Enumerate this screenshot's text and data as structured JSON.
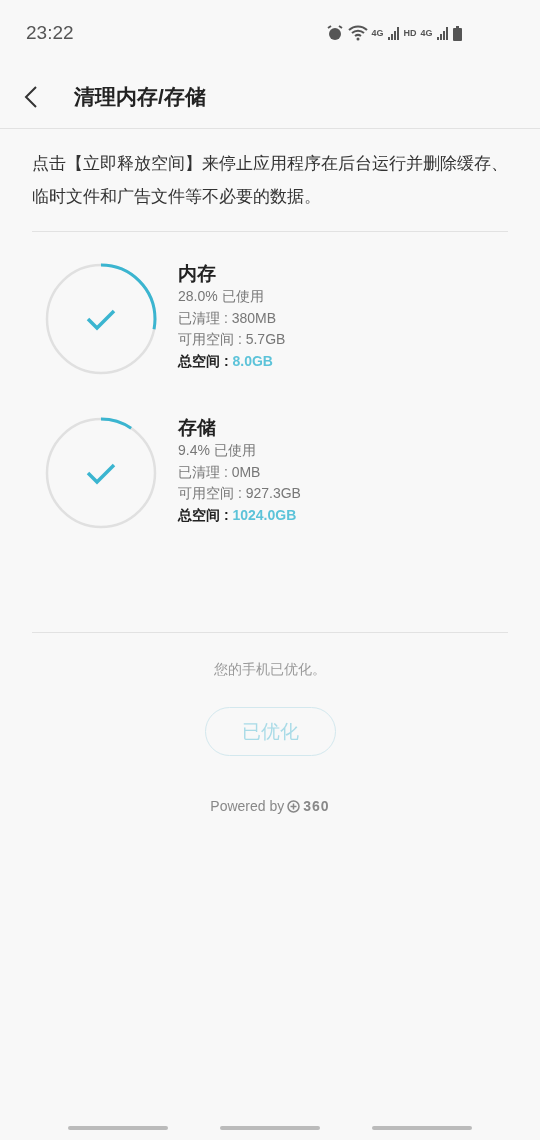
{
  "status_bar": {
    "time": "23:22",
    "network_1": "4G",
    "hd": "HD",
    "network_2": "4G"
  },
  "header": {
    "title": "清理内存/存储"
  },
  "description": "点击【立即释放空间】来停止应用程序在后台运行并删除缓存、临时文件和广告文件等不必要的数据。",
  "items": [
    {
      "title": "内存",
      "level": 0.28,
      "used": "28.0% 已使用",
      "cleaned": "已清理 : 380MB",
      "available": "可用空间 : 5.7GB",
      "total_label": "总空间 : ",
      "total_value": "8.0GB"
    },
    {
      "title": "存储",
      "level": 0.094,
      "used": "9.4% 已使用",
      "cleaned": "已清理 : 0MB",
      "available": "可用空间 : 927.3GB",
      "total_label": "总空间 : ",
      "total_value": "1024.0GB"
    }
  ],
  "status_message": "您的手机已优化。",
  "button": {
    "label": "已优化",
    "disabled": true
  },
  "footer": {
    "powered_by": "Powered by",
    "brand": "360"
  }
}
